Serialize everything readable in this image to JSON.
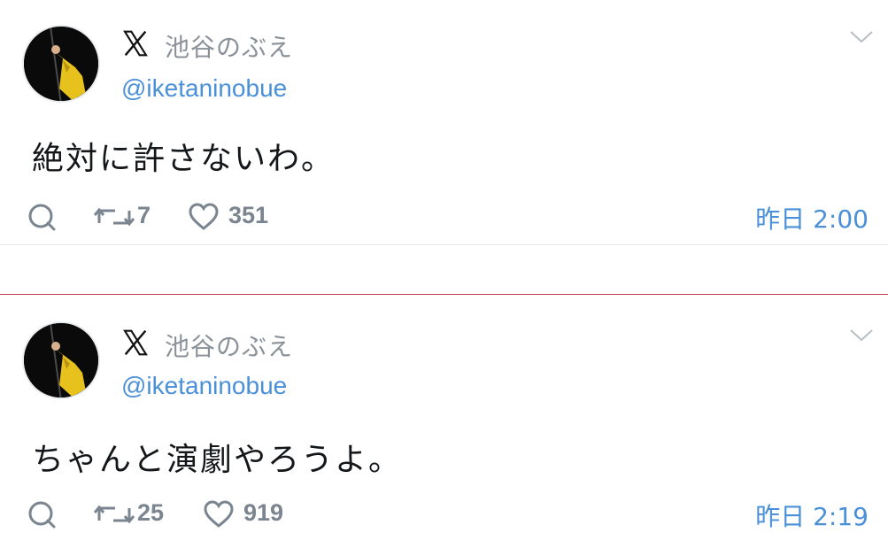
{
  "tweets": [
    {
      "icon": "x-logo-icon",
      "name": "池谷のぶえ",
      "handle": "@iketaninobue",
      "text": "絶対に許さないわ。",
      "retweets": "7",
      "likes": "351",
      "timestamp": "昨日 2:00"
    },
    {
      "icon": "x-logo-icon",
      "name": "池谷のぶえ",
      "handle": "@iketaninobue",
      "text": "ちゃんと演劇やろうよ。",
      "retweets": "25",
      "likes": "919",
      "timestamp": "昨日 2:19"
    }
  ],
  "colors": {
    "handle": "#4a90d9",
    "name": "#8a9199",
    "icon": "#7b8590",
    "divider": "#c93a4e"
  }
}
